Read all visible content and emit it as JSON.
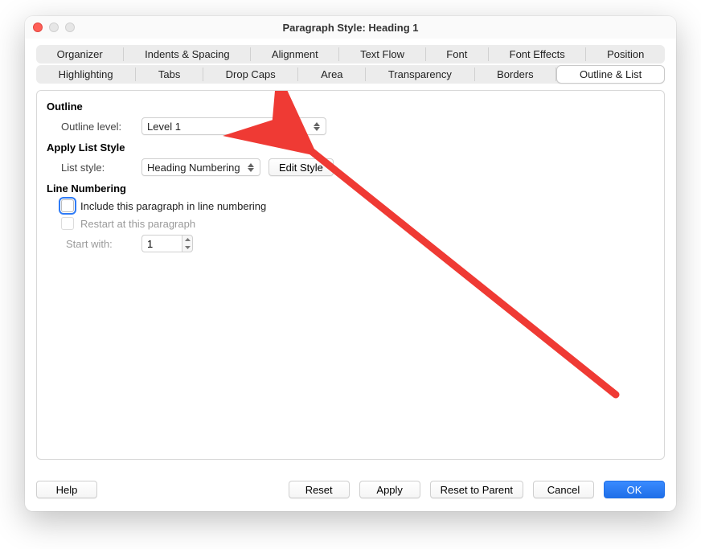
{
  "window": {
    "title": "Paragraph Style: Heading 1"
  },
  "tabs": {
    "row1": [
      "Organizer",
      "Indents & Spacing",
      "Alignment",
      "Text Flow",
      "Font",
      "Font Effects",
      "Position"
    ],
    "row2": [
      "Highlighting",
      "Tabs",
      "Drop Caps",
      "Area",
      "Transparency",
      "Borders",
      "Outline & List"
    ],
    "active": "Outline & List"
  },
  "sections": {
    "outline": {
      "header": "Outline",
      "level_label": "Outline level:",
      "level_value": "Level 1"
    },
    "list": {
      "header": "Apply List Style",
      "style_label": "List style:",
      "style_value": "Heading Numbering",
      "edit_btn": "Edit Style"
    },
    "linenum": {
      "header": "Line Numbering",
      "include_label": "Include this paragraph in line numbering",
      "restart_label": "Restart at this paragraph",
      "start_label": "Start with:",
      "start_value": "1"
    }
  },
  "footer": {
    "help": "Help",
    "reset": "Reset",
    "apply": "Apply",
    "reset_parent": "Reset to Parent",
    "cancel": "Cancel",
    "ok": "OK"
  }
}
